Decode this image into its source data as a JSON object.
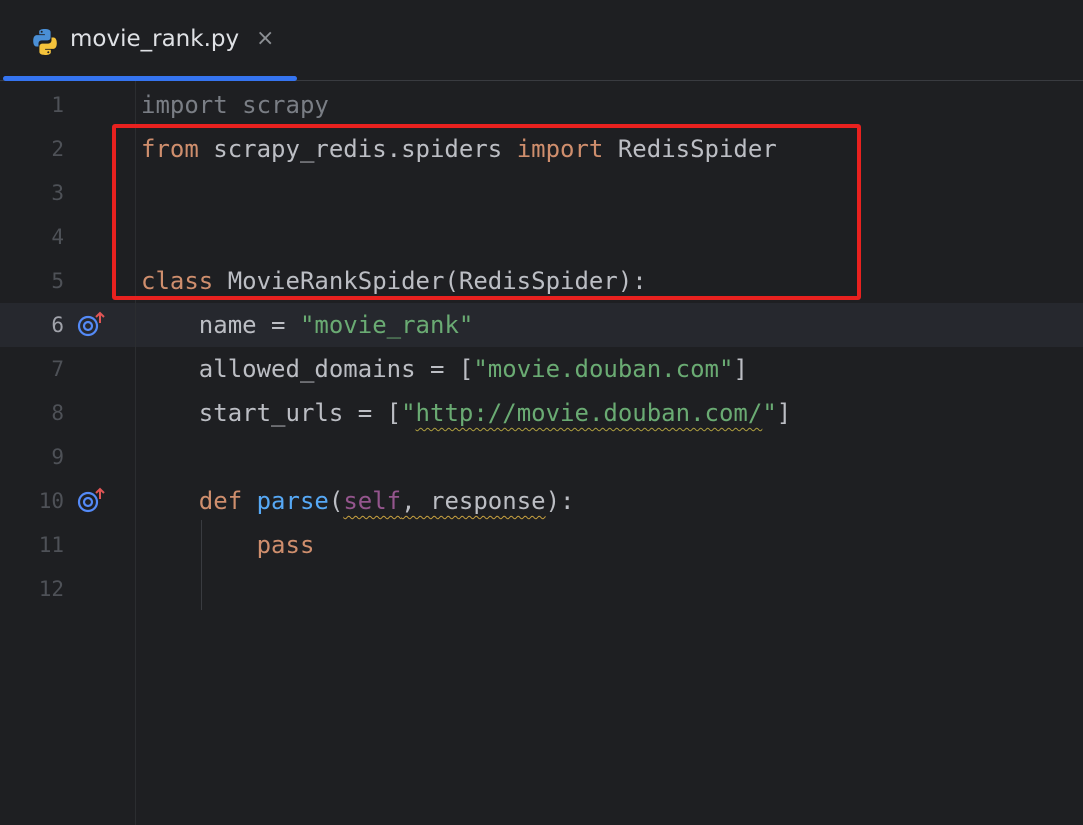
{
  "tab": {
    "filename": "movie_rank.py",
    "close_glyph": "×",
    "icon": "python-icon"
  },
  "colors": {
    "background": "#1e1f22",
    "keyword": "#cf8e6d",
    "string": "#6aab73",
    "function": "#56a8f5",
    "self": "#94558d",
    "text": "#bcbec4",
    "highlight_box": "#e8211f",
    "tab_accent": "#3574f0"
  },
  "lines": [
    {
      "n": "1"
    },
    {
      "n": "2"
    },
    {
      "n": "3"
    },
    {
      "n": "4"
    },
    {
      "n": "5"
    },
    {
      "n": "6"
    },
    {
      "n": "7"
    },
    {
      "n": "8"
    },
    {
      "n": "9"
    },
    {
      "n": "10"
    },
    {
      "n": "11"
    },
    {
      "n": "12"
    }
  ],
  "code": {
    "l1": {
      "kw": "import",
      "rest": " scrapy"
    },
    "l2": {
      "kw1": "from",
      "mod": " scrapy_redis.spiders ",
      "kw2": "import",
      "name": " RedisSpider"
    },
    "l5": {
      "kw": "class",
      "rest": " MovieRankSpider(RedisSpider):"
    },
    "l6": {
      "indent": "    ",
      "lhs": "name = ",
      "str": "\"movie_rank\""
    },
    "l7": {
      "indent": "    ",
      "lhs": "allowed_domains = [",
      "str": "\"movie.douban.com\"",
      "end": "]"
    },
    "l8": {
      "indent": "    ",
      "lhs": "start_urls = [",
      "q1": "\"",
      "url": "http://movie.douban.com/",
      "q2": "\"",
      "end": "]"
    },
    "l10": {
      "indent": "    ",
      "kw": "def",
      "sp": " ",
      "fn": "parse",
      "open": "(",
      "self": "self",
      "args": ", response",
      "close": "):"
    },
    "l11": {
      "indent": "        ",
      "kw": "pass"
    }
  },
  "gutter_icons": [
    "override-icon",
    "override-icon"
  ]
}
